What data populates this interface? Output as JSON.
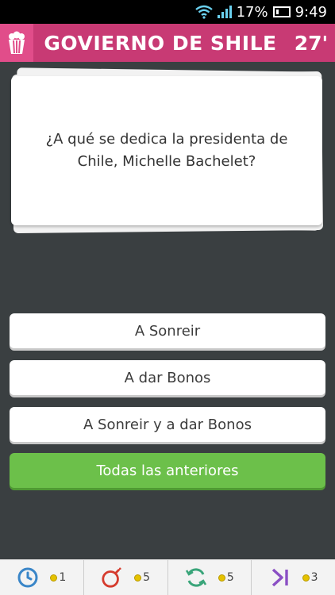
{
  "status_bar": {
    "battery_percent": "17%",
    "time": "9:49"
  },
  "header": {
    "category_title": "GOVIERNO DE SHILE",
    "timer": "27'",
    "category_icon": "popcorn-icon",
    "color": "#c83a74"
  },
  "question": {
    "text": "¿A qué se dedica la presidenta de Chile, Michelle Bachelet?"
  },
  "answers": [
    {
      "label": "A Sonreir",
      "state": "default"
    },
    {
      "label": "A dar Bonos",
      "state": "default"
    },
    {
      "label": "A Sonreir y a dar Bonos",
      "state": "default"
    },
    {
      "label": "Todas las anteriores",
      "state": "correct"
    }
  ],
  "powerups": [
    {
      "icon": "clock-icon",
      "cost": "1"
    },
    {
      "icon": "bomb-icon",
      "cost": "5"
    },
    {
      "icon": "refresh-icon",
      "cost": "5"
    },
    {
      "icon": "skip-icon",
      "cost": "3"
    }
  ],
  "colors": {
    "correct_green": "#6cc04a",
    "background": "#3a3f41"
  }
}
